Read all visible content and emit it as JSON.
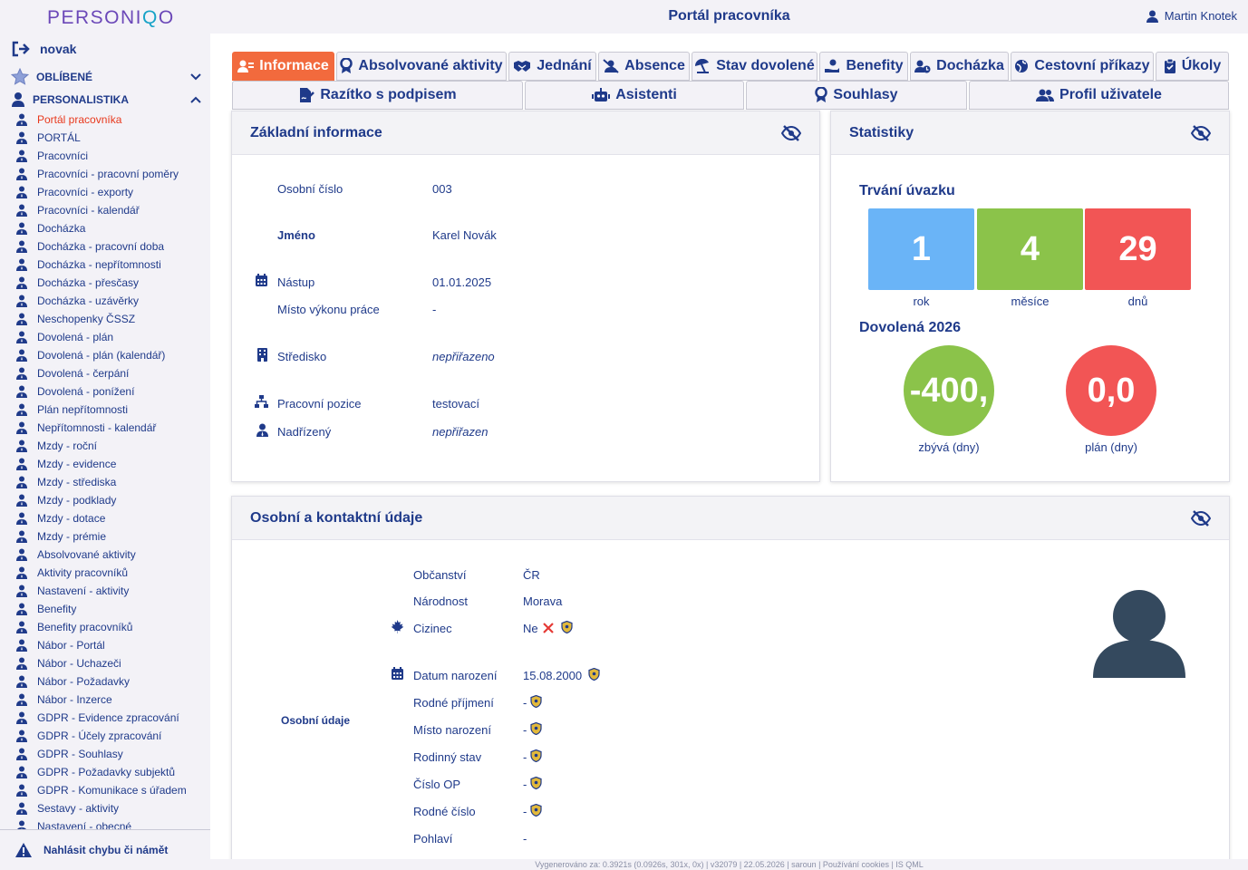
{
  "app": {
    "logo_main": "PERSONI",
    "logo_q": "Q",
    "logo_end": "O",
    "page_title": "Portál pracovníka",
    "user_name": "Martin Knotek"
  },
  "sidebar": {
    "user": "novak",
    "favorites_label": "OBLÍBENÉ",
    "hr_label": "PERSONALISTIKA",
    "items": [
      "Portál pracovníka",
      "PORTÁL",
      "Pracovníci",
      "Pracovníci - pracovní poměry",
      "Pracovníci - exporty",
      "Pracovníci - kalendář",
      "Docházka",
      "Docházka - pracovní doba",
      "Docházka - nepřítomnosti",
      "Docházka - přesčasy",
      "Docházka - uzávěrky",
      "Neschopenky ČSSZ",
      "Dovolená - plán",
      "Dovolená - plán (kalendář)",
      "Dovolená - čerpání",
      "Dovolená - ponížení",
      "Plán nepřítomnosti",
      "Nepřítomnosti - kalendář",
      "Mzdy - roční",
      "Mzdy - evidence",
      "Mzdy - střediska",
      "Mzdy - podklady",
      "Mzdy - dotace",
      "Mzdy - prémie",
      "Absolvované aktivity",
      "Aktivity pracovníků",
      "Nastavení - aktivity",
      "Benefity",
      "Benefity pracovníků",
      "Nábor - Portál",
      "Nábor - Uchazeči",
      "Nábor - Požadavky",
      "Nábor - Inzerce",
      "GDPR - Evidence zpracování",
      "GDPR - Účely zpracování",
      "GDPR - Souhlasy",
      "GDPR - Požadavky subjektů",
      "GDPR - Komunikace s úřadem",
      "Sestavy - aktivity",
      "Nastavení - obecné"
    ],
    "report_label": "Nahlásit chybu či námět"
  },
  "tabs": {
    "row1": [
      "Informace",
      "Absolvované aktivity",
      "Jednání",
      "Absence",
      "Stav dovolené",
      "Benefity",
      "Docházka",
      "Cestovní příkazy",
      "Úkoly"
    ],
    "row2": [
      "Razítko s podpisem",
      "Asistenti",
      "Souhlasy",
      "Profil uživatele"
    ]
  },
  "basic_info": {
    "title": "Základní informace",
    "personal_number_label": "Osobní číslo",
    "personal_number": "003",
    "name_label": "Jméno",
    "name": "Karel Novák",
    "start_label": "Nástup",
    "start": "01.01.2025",
    "workplace_label": "Místo výkonu práce",
    "workplace": "-",
    "center_label": "Středisko",
    "center": "nepřiřazeno",
    "position_label": "Pracovní pozice",
    "position": "testovací",
    "supervisor_label": "Nadřízený",
    "supervisor": "nepřiřazen"
  },
  "stats": {
    "title": "Statistiky",
    "duration_title": "Trvání úvazku",
    "years": "1",
    "years_label": "rok",
    "months": "4",
    "months_label": "měsíce",
    "days": "29",
    "days_label": "dnů",
    "vacation_title": "Dovolená 2026",
    "remaining": "-400,",
    "remaining_label": "zbývá (dny)",
    "plan": "0,0",
    "plan_label": "plán (dny)",
    "colors": {
      "years": "#6ab4f7",
      "months": "#8bc34a",
      "days": "#f25555",
      "remaining": "#8bc34a",
      "plan": "#f25555"
    }
  },
  "personal": {
    "title": "Osobní a kontaktní údaje",
    "section_label": "Osobní údaje",
    "citizenship_label": "Občanství",
    "citizenship": "ČR",
    "nationality_label": "Národnost",
    "nationality": "Morava",
    "foreigner_label": "Cizinec",
    "foreigner": "Ne",
    "birth_date_label": "Datum narození",
    "birth_date": "15.08.2000",
    "birth_name_label": "Rodné příjmení",
    "birth_name": "-",
    "birth_place_label": "Místo narození",
    "birth_place": "-",
    "marital_label": "Rodinný stav",
    "marital": "-",
    "id_card_label": "Číslo OP",
    "id_card": "-",
    "birth_number_label": "Rodné číslo",
    "birth_number": "-",
    "gender_label": "Pohlaví",
    "gender": "-"
  },
  "footer": "Vygenerováno za: 0.3921s (0.0926s, 301x, 0x) | v32079 | 22.05.2026 | saroun | Používání cookies | IS QML"
}
